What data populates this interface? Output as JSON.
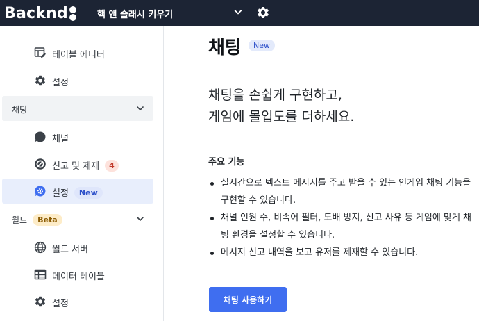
{
  "topbar": {
    "logo_text": "Backnd",
    "project_name": "핵 앤 슬래시 키우기"
  },
  "sidebar": {
    "items_top": [
      {
        "label": "테이블 에디터",
        "icon": "table-edit-icon"
      },
      {
        "label": "설정",
        "icon": "gear-icon"
      }
    ],
    "chat_section": {
      "label": "채팅",
      "items": [
        {
          "label": "채널",
          "icon": "chat-bubble-icon"
        },
        {
          "label": "신고 및 제재",
          "icon": "block-icon",
          "badge": "4"
        },
        {
          "label": "설정",
          "icon": "chat-settings-icon",
          "badge": "New"
        }
      ]
    },
    "guild_section": {
      "label": "월드",
      "badge": "Beta",
      "items": [
        {
          "label": "월드 서버",
          "icon": "globe-icon"
        },
        {
          "label": "데이터 테이블",
          "icon": "table-icon"
        },
        {
          "label": "설정",
          "icon": "gear-icon"
        }
      ]
    }
  },
  "main": {
    "title": "채팅",
    "title_badge": "New",
    "headline_line1": "채팅을 손쉽게 구현하고,",
    "headline_line2": "게임에 몰입도를 더하세요.",
    "features_title": "주요 기능",
    "features": [
      "실시간으로 텍스트 메시지를 주고 받을 수 있는 인게임 채팅 기능을 구현할 수 있습니다.",
      "채널 인원 수, 비속어 필터, 도배 방지, 신고 사유 등 게임에 맞게 채팅 환경을 설정할 수 있습니다.",
      "메시지 신고 내역을 보고 유저를 제재할 수 있습니다."
    ],
    "cta_label": "채팅 사용하기"
  },
  "colors": {
    "topbar_bg": "#1c2434",
    "accent": "#3f6ef0",
    "active_bg": "#e8eefc"
  }
}
